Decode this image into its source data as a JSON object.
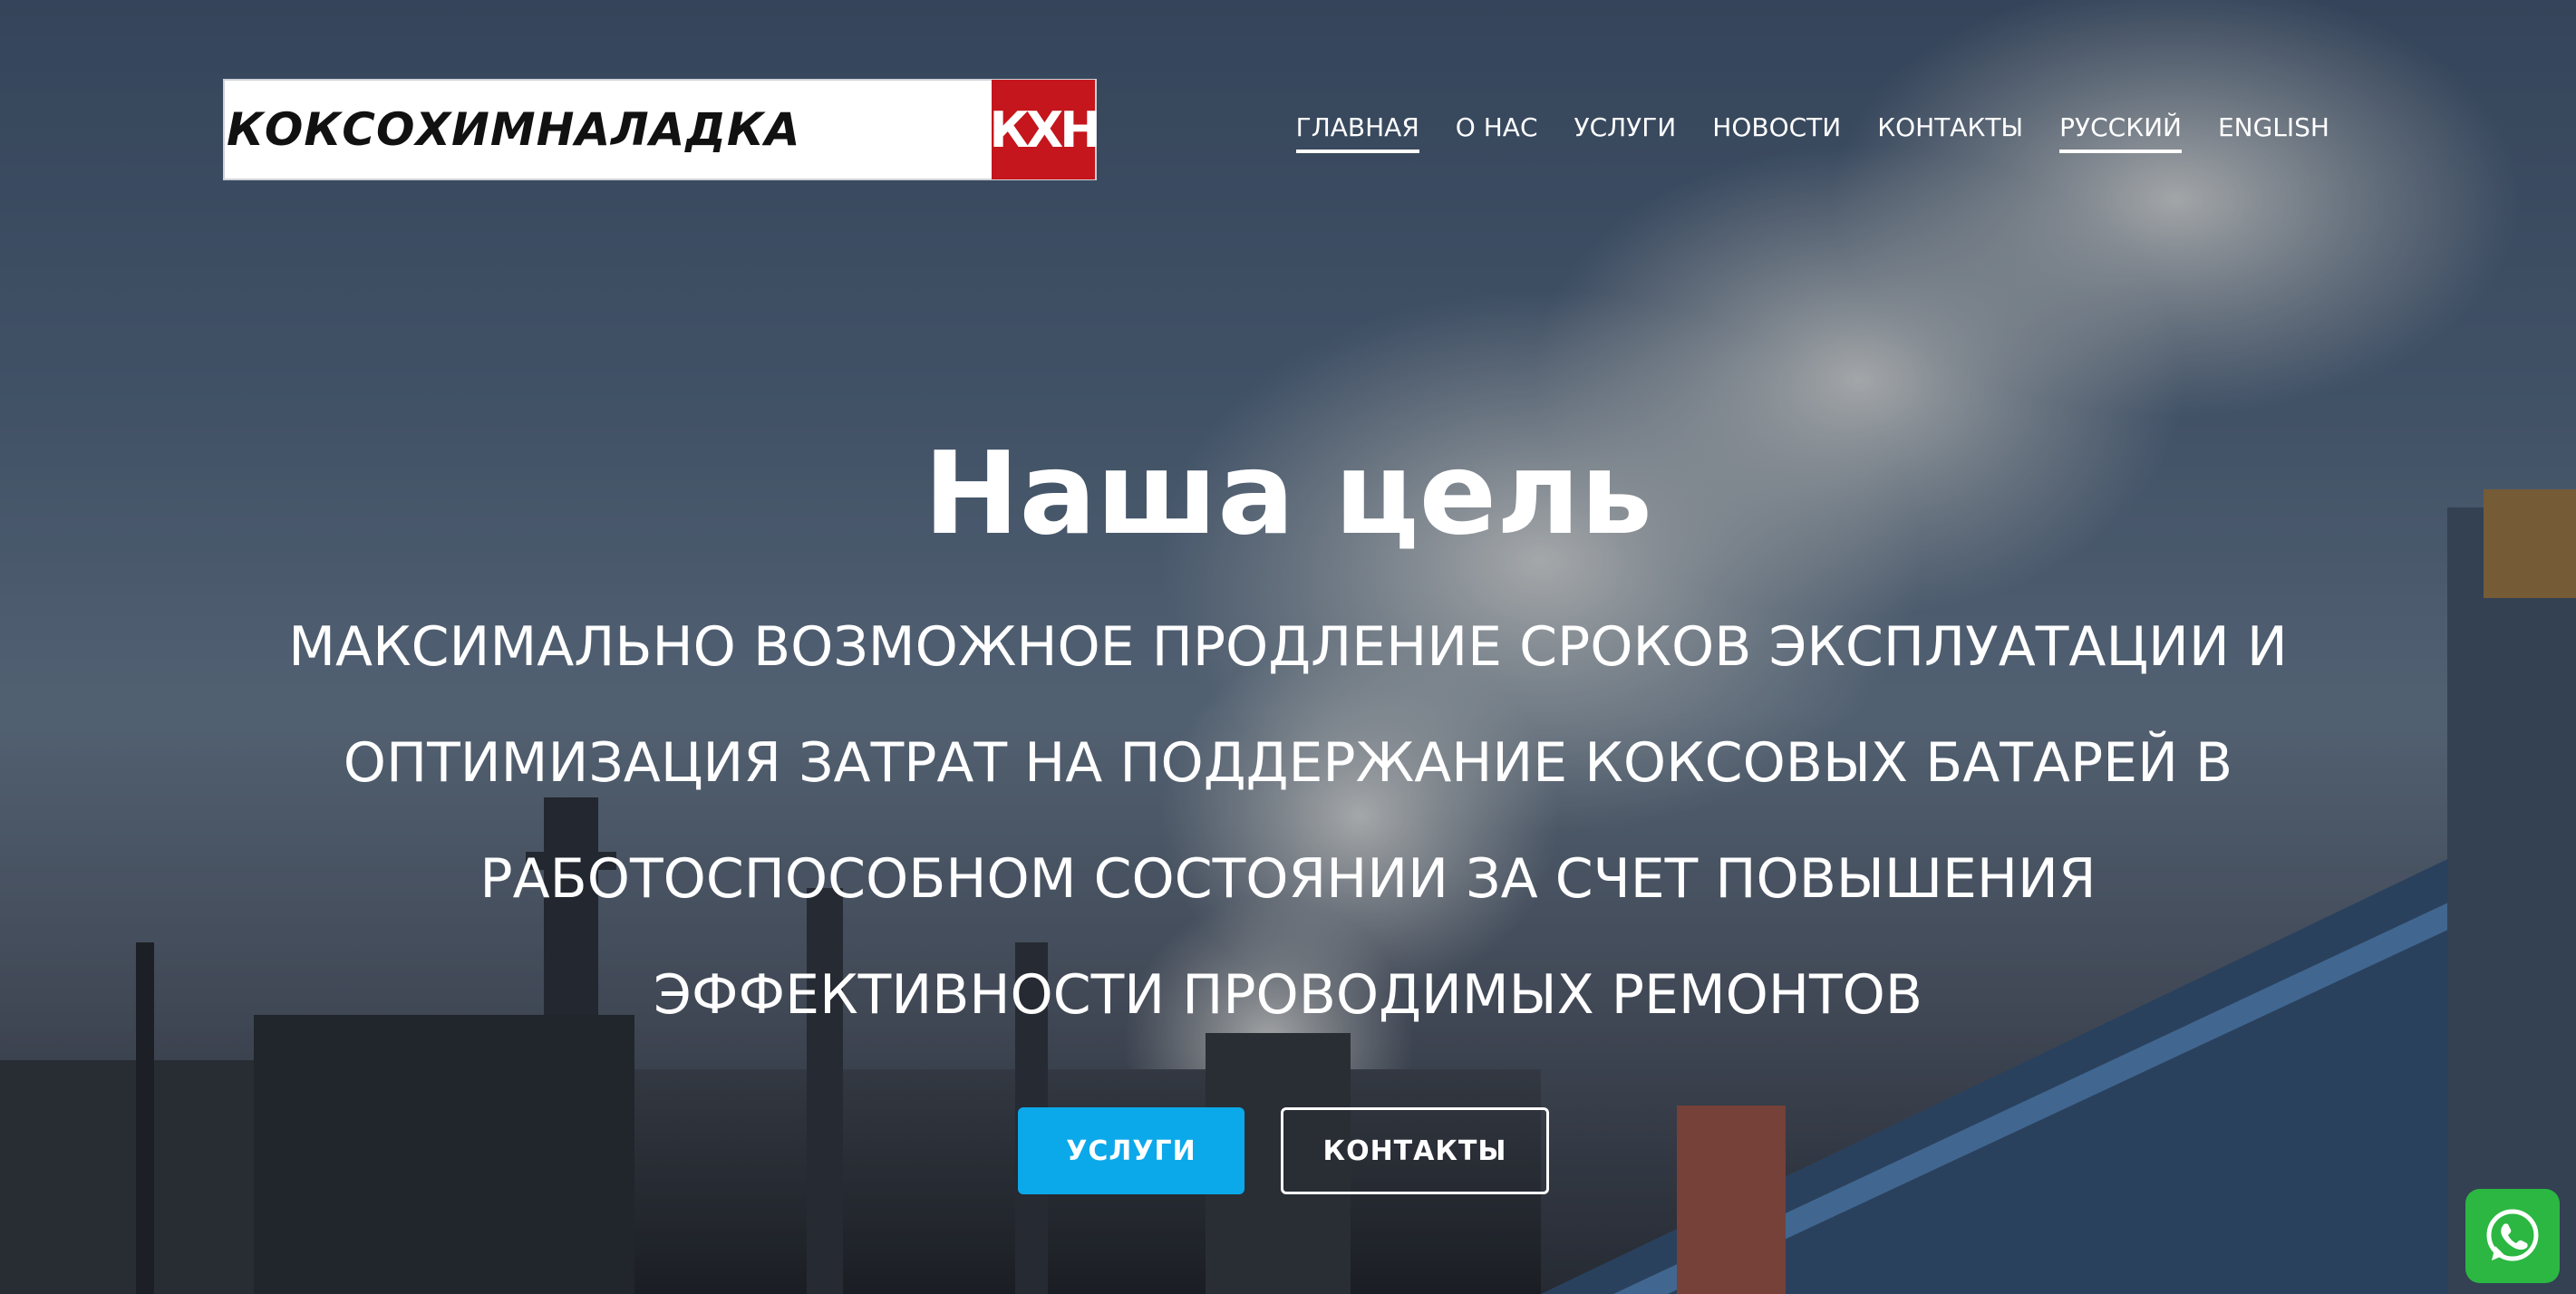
{
  "brand": {
    "logo_text": "КОКСОХИМНАЛАДКА",
    "logo_mark": "КХН",
    "logo_color": "#c4161c"
  },
  "nav": {
    "items": [
      {
        "label": "ГЛАВНАЯ",
        "active": true
      },
      {
        "label": "О НАС",
        "active": false
      },
      {
        "label": "УСЛУГИ",
        "active": false
      },
      {
        "label": "НОВОСТИ",
        "active": false
      },
      {
        "label": "КОНТАКТЫ",
        "active": false
      },
      {
        "label": "РУССКИЙ",
        "active": true
      },
      {
        "label": "ENGLISH",
        "active": false
      }
    ]
  },
  "hero": {
    "title": "Наша цель",
    "subtitle": "МАКСИМАЛЬНО ВОЗМОЖНОЕ ПРОДЛЕНИЕ СРОКОВ ЭКСПЛУАТАЦИИ И ОПТИМИЗАЦИЯ ЗАТРАТ НА ПОДДЕРЖАНИЕ КОКСОВЫХ БАТАРЕЙ В РАБОТОСПОСОБНОМ СОСТОЯНИИ ЗА СЧЕТ ПОВЫШЕНИЯ ЭФФЕКТИВНОСТИ ПРОВОДИМЫХ РЕМОНТОВ",
    "primary_button": "УСЛУГИ",
    "secondary_button": "КОНТАКТЫ",
    "accent_color": "#0ba9ea"
  },
  "chat_widget": {
    "icon": "whatsapp-icon",
    "color": "#2bb741"
  }
}
